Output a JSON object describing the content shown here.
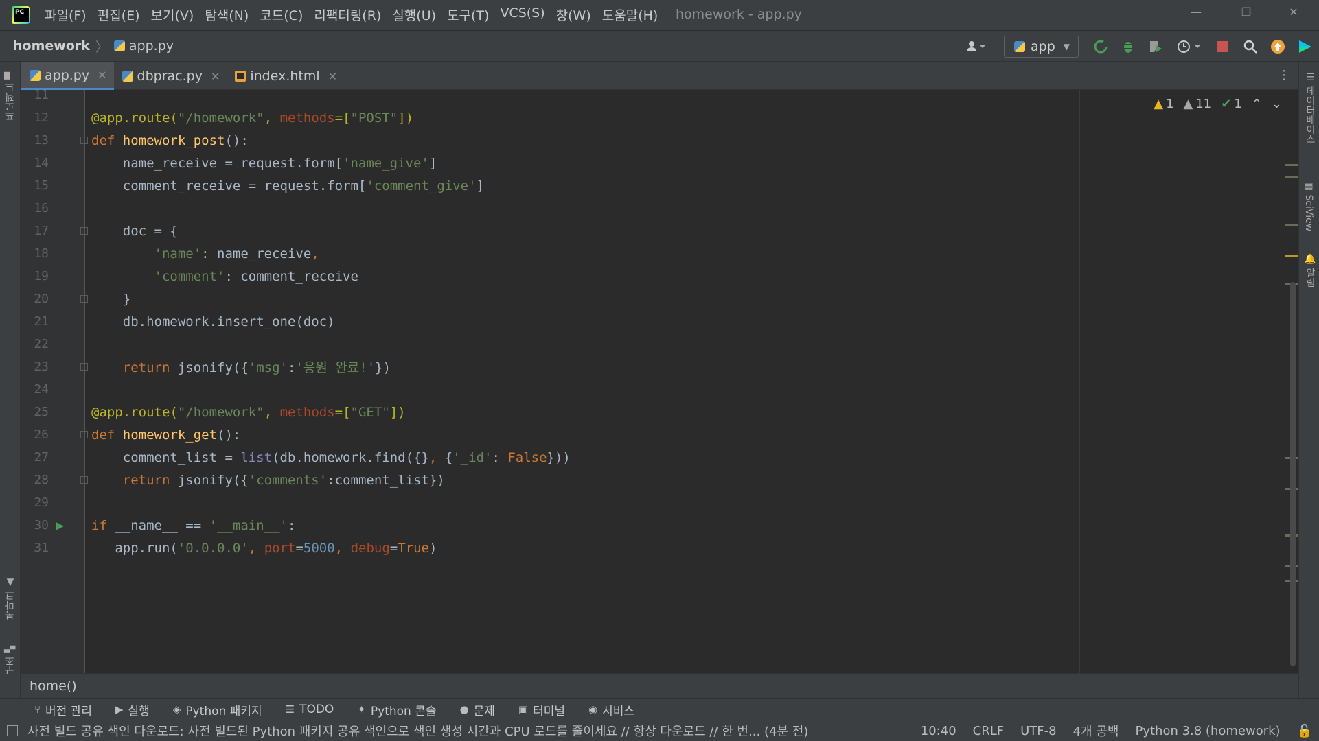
{
  "window": {
    "title": "homework - app.py",
    "minimize": "—",
    "restore": "❐",
    "close": "✕"
  },
  "menu": [
    "파일(F)",
    "편집(E)",
    "보기(V)",
    "탐색(N)",
    "코드(C)",
    "리팩터링(R)",
    "실행(U)",
    "도구(T)",
    "VCS(S)",
    "창(W)",
    "도움말(H)"
  ],
  "breadcrumb": {
    "project": "homework",
    "file": "app.py"
  },
  "toolbar": {
    "run_config": "app"
  },
  "tabs": [
    {
      "label": "app.py",
      "type": "py",
      "active": true
    },
    {
      "label": "dbprac.py",
      "type": "py",
      "active": false
    },
    {
      "label": "index.html",
      "type": "html",
      "active": false
    }
  ],
  "inspections": {
    "warnings_yellow": "1",
    "warnings_gray": "11",
    "ok": "1"
  },
  "left_strip": {
    "project": "프로젝트",
    "bookmarks": "북마크",
    "structure": "구조"
  },
  "right_strip": {
    "database": "데이터베이스",
    "sciview": "SciView",
    "notifications": "알림"
  },
  "code": {
    "line_numbers": [
      "11",
      "12",
      "13",
      "14",
      "15",
      "16",
      "17",
      "18",
      "19",
      "20",
      "21",
      "22",
      "23",
      "24",
      "25",
      "26",
      "27",
      "28",
      "29",
      "30",
      "31"
    ]
  },
  "structure_bar": {
    "text": "home()"
  },
  "tool_windows": [
    "버전 관리",
    "실행",
    "Python 패키지",
    "TODO",
    "Python 콘솔",
    "문제",
    "터미널",
    "서비스"
  ],
  "status": {
    "message": "사전 빌드 공유 색인 다운로드: 사전 빌드된 Python 패키지 공유 색인으로 색인 생성 시간과 CPU 로드를 줄이세요 // 항상 다운로드 // 한 번... (4분 전)",
    "position": "10:40",
    "line_sep": "CRLF",
    "encoding": "UTF-8",
    "indent": "4개 공백",
    "interpreter": "Python 3.8 (homework)"
  }
}
